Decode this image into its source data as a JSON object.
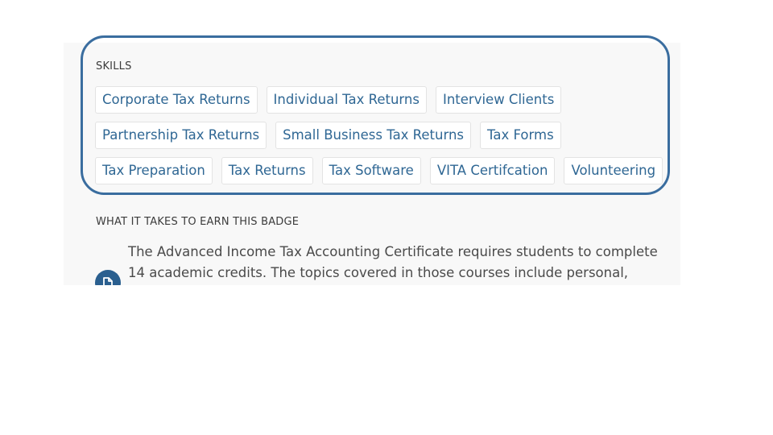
{
  "skills": {
    "title": "SKILLS",
    "rows": [
      [
        "Corporate Tax Returns",
        "Individual Tax Returns",
        "Interview Clients"
      ],
      [
        "Partnership Tax Returns",
        "Small Business Tax Returns",
        "Tax Forms"
      ],
      [
        "Tax Preparation",
        "Tax Returns",
        "Tax Software",
        "VITA Certifcation",
        "Volunteering"
      ]
    ]
  },
  "earn": {
    "title": "WHAT IT TAKES TO EARN THIS BADGE",
    "text": "The Advanced Income Tax Accounting Certificate requires students to complete 14 academic credits.  The topics covered in those courses include personal, partnership,",
    "icon": "document-icon"
  },
  "colors": {
    "accent": "#2f6794",
    "highlight_frame": "#3a6d9f",
    "panel_bg": "#f8f8f8",
    "icon_bg": "#2a5f8f"
  }
}
